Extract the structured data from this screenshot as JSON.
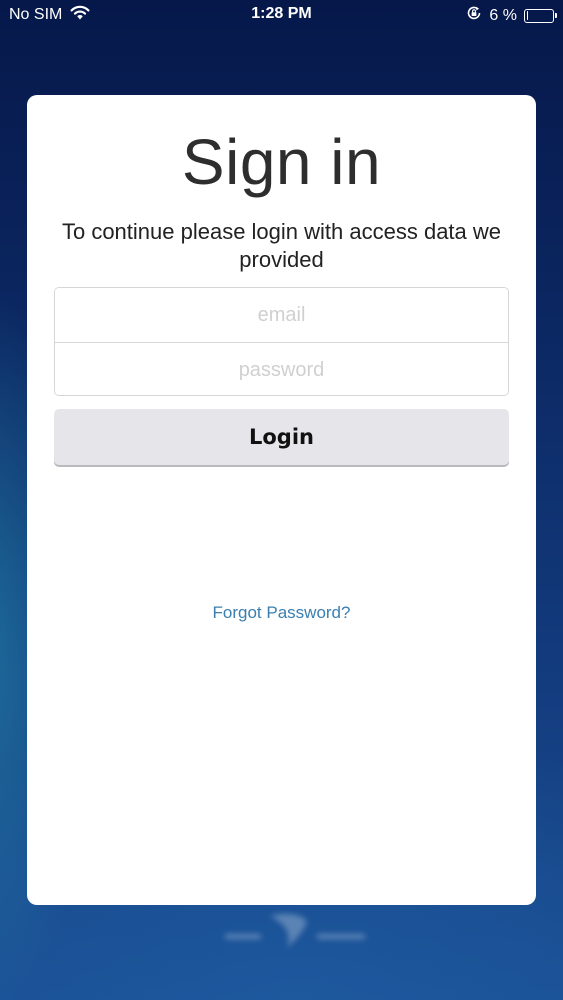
{
  "status_bar": {
    "carrier": "No SIM",
    "time": "1:28 PM",
    "battery_text": "6 %",
    "battery_level": 0.06,
    "icons": [
      "wifi-icon",
      "orientation-lock-icon",
      "battery-icon"
    ]
  },
  "signin": {
    "title": "Sign in",
    "subtitle": "To continue please login with access data we provided",
    "email_placeholder": "email",
    "password_placeholder": "password",
    "login_label": "Login",
    "forgot_label": "Forgot Password?"
  },
  "colors": {
    "accent_link": "#3a7fb0",
    "button_bg": "#e6e5e9",
    "background_dark": "#0b2660"
  }
}
